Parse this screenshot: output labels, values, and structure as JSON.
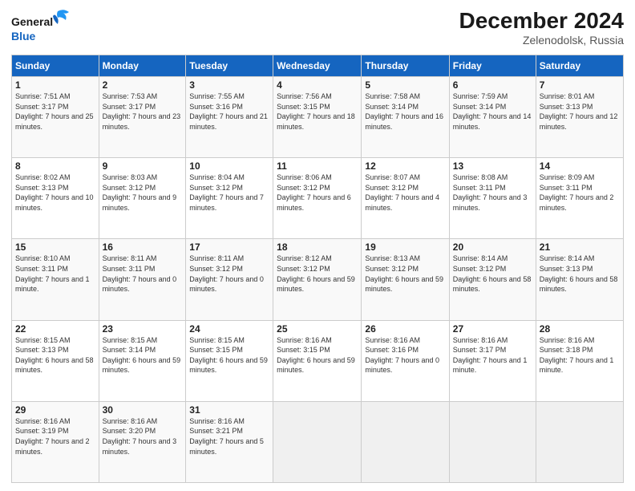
{
  "header": {
    "logo_line1": "General",
    "logo_line2": "Blue",
    "month": "December 2024",
    "location": "Zelenodolsk, Russia"
  },
  "days_of_week": [
    "Sunday",
    "Monday",
    "Tuesday",
    "Wednesday",
    "Thursday",
    "Friday",
    "Saturday"
  ],
  "weeks": [
    [
      {
        "day": "1",
        "sunrise": "Sunrise: 7:51 AM",
        "sunset": "Sunset: 3:17 PM",
        "daylight": "Daylight: 7 hours and 25 minutes."
      },
      {
        "day": "2",
        "sunrise": "Sunrise: 7:53 AM",
        "sunset": "Sunset: 3:17 PM",
        "daylight": "Daylight: 7 hours and 23 minutes."
      },
      {
        "day": "3",
        "sunrise": "Sunrise: 7:55 AM",
        "sunset": "Sunset: 3:16 PM",
        "daylight": "Daylight: 7 hours and 21 minutes."
      },
      {
        "day": "4",
        "sunrise": "Sunrise: 7:56 AM",
        "sunset": "Sunset: 3:15 PM",
        "daylight": "Daylight: 7 hours and 18 minutes."
      },
      {
        "day": "5",
        "sunrise": "Sunrise: 7:58 AM",
        "sunset": "Sunset: 3:14 PM",
        "daylight": "Daylight: 7 hours and 16 minutes."
      },
      {
        "day": "6",
        "sunrise": "Sunrise: 7:59 AM",
        "sunset": "Sunset: 3:14 PM",
        "daylight": "Daylight: 7 hours and 14 minutes."
      },
      {
        "day": "7",
        "sunrise": "Sunrise: 8:01 AM",
        "sunset": "Sunset: 3:13 PM",
        "daylight": "Daylight: 7 hours and 12 minutes."
      }
    ],
    [
      {
        "day": "8",
        "sunrise": "Sunrise: 8:02 AM",
        "sunset": "Sunset: 3:13 PM",
        "daylight": "Daylight: 7 hours and 10 minutes."
      },
      {
        "day": "9",
        "sunrise": "Sunrise: 8:03 AM",
        "sunset": "Sunset: 3:12 PM",
        "daylight": "Daylight: 7 hours and 9 minutes."
      },
      {
        "day": "10",
        "sunrise": "Sunrise: 8:04 AM",
        "sunset": "Sunset: 3:12 PM",
        "daylight": "Daylight: 7 hours and 7 minutes."
      },
      {
        "day": "11",
        "sunrise": "Sunrise: 8:06 AM",
        "sunset": "Sunset: 3:12 PM",
        "daylight": "Daylight: 7 hours and 6 minutes."
      },
      {
        "day": "12",
        "sunrise": "Sunrise: 8:07 AM",
        "sunset": "Sunset: 3:12 PM",
        "daylight": "Daylight: 7 hours and 4 minutes."
      },
      {
        "day": "13",
        "sunrise": "Sunrise: 8:08 AM",
        "sunset": "Sunset: 3:11 PM",
        "daylight": "Daylight: 7 hours and 3 minutes."
      },
      {
        "day": "14",
        "sunrise": "Sunrise: 8:09 AM",
        "sunset": "Sunset: 3:11 PM",
        "daylight": "Daylight: 7 hours and 2 minutes."
      }
    ],
    [
      {
        "day": "15",
        "sunrise": "Sunrise: 8:10 AM",
        "sunset": "Sunset: 3:11 PM",
        "daylight": "Daylight: 7 hours and 1 minute."
      },
      {
        "day": "16",
        "sunrise": "Sunrise: 8:11 AM",
        "sunset": "Sunset: 3:11 PM",
        "daylight": "Daylight: 7 hours and 0 minutes."
      },
      {
        "day": "17",
        "sunrise": "Sunrise: 8:11 AM",
        "sunset": "Sunset: 3:12 PM",
        "daylight": "Daylight: 7 hours and 0 minutes."
      },
      {
        "day": "18",
        "sunrise": "Sunrise: 8:12 AM",
        "sunset": "Sunset: 3:12 PM",
        "daylight": "Daylight: 6 hours and 59 minutes."
      },
      {
        "day": "19",
        "sunrise": "Sunrise: 8:13 AM",
        "sunset": "Sunset: 3:12 PM",
        "daylight": "Daylight: 6 hours and 59 minutes."
      },
      {
        "day": "20",
        "sunrise": "Sunrise: 8:14 AM",
        "sunset": "Sunset: 3:12 PM",
        "daylight": "Daylight: 6 hours and 58 minutes."
      },
      {
        "day": "21",
        "sunrise": "Sunrise: 8:14 AM",
        "sunset": "Sunset: 3:13 PM",
        "daylight": "Daylight: 6 hours and 58 minutes."
      }
    ],
    [
      {
        "day": "22",
        "sunrise": "Sunrise: 8:15 AM",
        "sunset": "Sunset: 3:13 PM",
        "daylight": "Daylight: 6 hours and 58 minutes."
      },
      {
        "day": "23",
        "sunrise": "Sunrise: 8:15 AM",
        "sunset": "Sunset: 3:14 PM",
        "daylight": "Daylight: 6 hours and 59 minutes."
      },
      {
        "day": "24",
        "sunrise": "Sunrise: 8:15 AM",
        "sunset": "Sunset: 3:15 PM",
        "daylight": "Daylight: 6 hours and 59 minutes."
      },
      {
        "day": "25",
        "sunrise": "Sunrise: 8:16 AM",
        "sunset": "Sunset: 3:15 PM",
        "daylight": "Daylight: 6 hours and 59 minutes."
      },
      {
        "day": "26",
        "sunrise": "Sunrise: 8:16 AM",
        "sunset": "Sunset: 3:16 PM",
        "daylight": "Daylight: 7 hours and 0 minutes."
      },
      {
        "day": "27",
        "sunrise": "Sunrise: 8:16 AM",
        "sunset": "Sunset: 3:17 PM",
        "daylight": "Daylight: 7 hours and 1 minute."
      },
      {
        "day": "28",
        "sunrise": "Sunrise: 8:16 AM",
        "sunset": "Sunset: 3:18 PM",
        "daylight": "Daylight: 7 hours and 1 minute."
      }
    ],
    [
      {
        "day": "29",
        "sunrise": "Sunrise: 8:16 AM",
        "sunset": "Sunset: 3:19 PM",
        "daylight": "Daylight: 7 hours and 2 minutes."
      },
      {
        "day": "30",
        "sunrise": "Sunrise: 8:16 AM",
        "sunset": "Sunset: 3:20 PM",
        "daylight": "Daylight: 7 hours and 3 minutes."
      },
      {
        "day": "31",
        "sunrise": "Sunrise: 8:16 AM",
        "sunset": "Sunset: 3:21 PM",
        "daylight": "Daylight: 7 hours and 5 minutes."
      },
      {
        "day": "",
        "sunrise": "",
        "sunset": "",
        "daylight": ""
      },
      {
        "day": "",
        "sunrise": "",
        "sunset": "",
        "daylight": ""
      },
      {
        "day": "",
        "sunrise": "",
        "sunset": "",
        "daylight": ""
      },
      {
        "day": "",
        "sunrise": "",
        "sunset": "",
        "daylight": ""
      }
    ]
  ]
}
